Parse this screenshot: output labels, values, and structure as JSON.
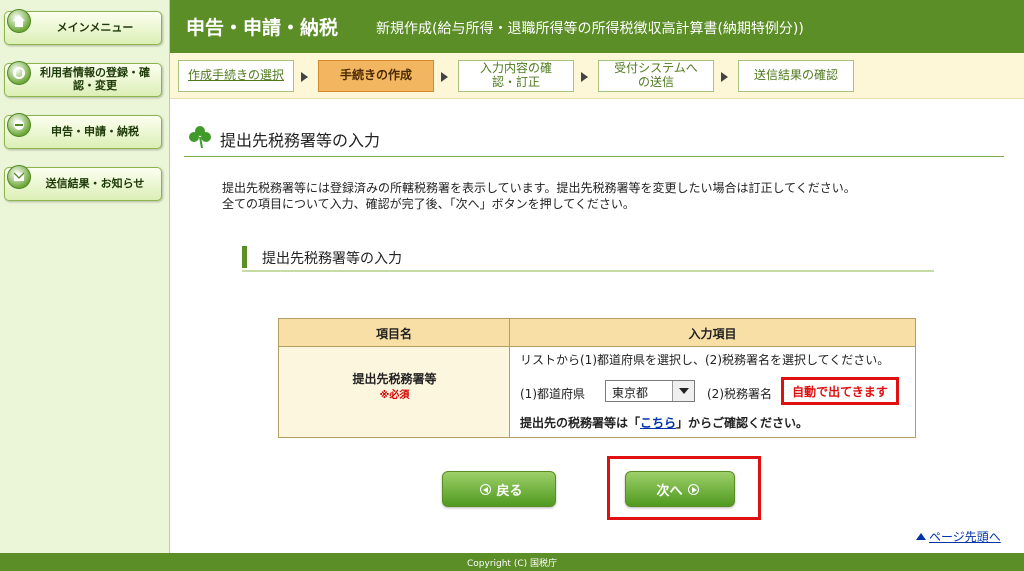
{
  "sidebar": {
    "items": [
      {
        "label": "メインメニュー",
        "icon": "home-icon"
      },
      {
        "label": "利用者情報の登録・確認・変更",
        "icon": "user-settings-icon"
      },
      {
        "label": "申告・申請・納税",
        "icon": "filing-icon"
      },
      {
        "label": "送信結果・お知らせ",
        "icon": "mail-icon"
      }
    ]
  },
  "header": {
    "title": "申告・申請・納税",
    "subtitle": "新規作成(給与所得・退職所得等の所得税徴収高計算書(納期特例分))"
  },
  "steps": [
    {
      "label": "作成手続きの選択",
      "state": "link"
    },
    {
      "label": "手続きの作成",
      "state": "current"
    },
    {
      "label": "入力内容の確認・訂正",
      "state": "pending"
    },
    {
      "label": "受付システムへの送信",
      "state": "pending"
    },
    {
      "label": "送信結果の確認",
      "state": "pending"
    }
  ],
  "main": {
    "page_title": "提出先税務署等の入力",
    "description_line1": "提出先税務署等には登録済みの所轄税務署を表示しています。提出先税務署等を変更したい場合は訂正してください。",
    "description_line2": "全ての項目について入力、確認が完了後、「次へ」ボタンを押してください。",
    "section_title": "提出先税務署等の入力",
    "table": {
      "header_name": "項目名",
      "header_input": "入力項目",
      "row_label": "提出先税務署等",
      "required_mark": "※必須",
      "instruction": "リストから(1)都道府県を選択し、(2)税務署名を選択してください。",
      "prefecture_label": "(1)都道府県",
      "prefecture_value": "東京都",
      "office_label": "(2)税務署名",
      "auto_note": "自動で出てきます",
      "confirm_prefix": "提出先の税務署等は「",
      "confirm_link": "こちら",
      "confirm_suffix": "」からご確認ください。"
    },
    "back_label": "戻る",
    "next_label": "次へ",
    "page_top_label": "ページ先頭へ"
  },
  "footer": {
    "copyright": "Copyright (C) 国税庁"
  },
  "colors": {
    "header_green": "#5c8e27",
    "current_step": "#f3b660",
    "highlight_red": "#e01010"
  }
}
